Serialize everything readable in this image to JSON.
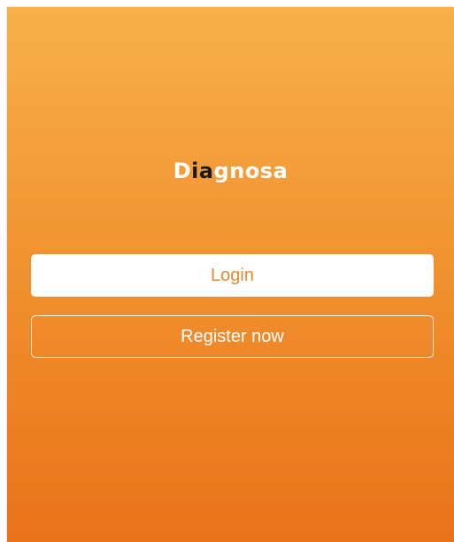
{
  "app": {
    "title_part1": "D",
    "title_part2": "ia",
    "title_part3": "gnosa"
  },
  "actions": {
    "login_label": "Login",
    "register_label": "Register now"
  },
  "colors": {
    "gradient_top": "#f7b14a",
    "gradient_bottom": "#e9731a",
    "login_text": "#e98a2c",
    "title_accent": "#1a1a1a"
  }
}
